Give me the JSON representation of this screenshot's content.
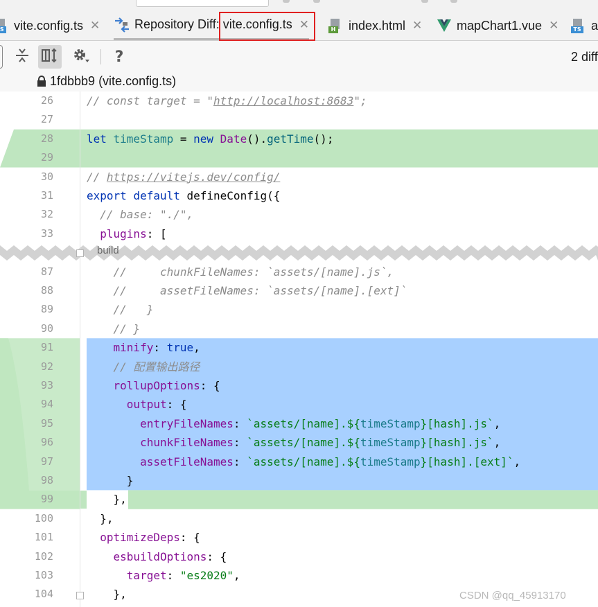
{
  "tabs": [
    {
      "label": "vite.config.ts",
      "icon": "ts-file-icon",
      "active": false
    },
    {
      "label": "Repository Diff: vite.config.ts",
      "icon": "repository-diff-icon",
      "active": true
    },
    {
      "label": "index.html",
      "icon": "html-file-icon",
      "active": false
    },
    {
      "label": "mapChart1.vue",
      "icon": "vue-file-icon",
      "active": false
    },
    {
      "label": "ap",
      "icon": "ts-file-icon",
      "active": false
    }
  ],
  "tab_badges": {
    "ts": "TS",
    "html": "H"
  },
  "toolbar": {
    "buttons": [
      "collapse-unchanged-icon",
      "side-by-side-icon",
      "settings-icon",
      "help-icon"
    ],
    "diff_count": "2 diff"
  },
  "title": "1fdbbb9 (vite.config.ts)",
  "fold_label": "build",
  "colors": {
    "added": "#bfe6c0",
    "modified": "#a8d0ff",
    "highlight_box": "#e02020"
  },
  "lines": [
    {
      "n": "26",
      "code": [
        {
          "t": "// const target = \"",
          "c": "cmt"
        },
        {
          "t": "http://localhost:8683",
          "c": "url"
        },
        {
          "t": "\";",
          "c": "cmt"
        }
      ]
    },
    {
      "n": "27",
      "code": []
    },
    {
      "n": "28",
      "code": [
        {
          "t": "let ",
          "c": "kw"
        },
        {
          "t": "timeStamp",
          "c": "var"
        },
        {
          "t": " = "
        },
        {
          "t": "new ",
          "c": "kw"
        },
        {
          "t": "Date",
          "c": "prop"
        },
        {
          "t": "()."
        },
        {
          "t": "getTime",
          "c": "fn"
        },
        {
          "t": "();"
        }
      ]
    },
    {
      "n": "29",
      "code": []
    },
    {
      "n": "30",
      "code": [
        {
          "t": "// ",
          "c": "cmt"
        },
        {
          "t": "https://vitejs.dev/config/",
          "c": "url"
        }
      ]
    },
    {
      "n": "31",
      "code": [
        {
          "t": "export ",
          "c": "kw"
        },
        {
          "t": "default ",
          "c": "kw"
        },
        {
          "t": "defineConfig({"
        }
      ]
    },
    {
      "n": "32",
      "code": [
        {
          "t": "  // base: \"./\",",
          "c": "cmt"
        }
      ]
    },
    {
      "n": "33",
      "code": [
        {
          "t": "  "
        },
        {
          "t": "plugins",
          "c": "prop"
        },
        {
          "t": ": ["
        }
      ]
    },
    {
      "n": "87",
      "code": [
        {
          "t": "    //     chunkFileNames: `assets/[name].js`,",
          "c": "cmt"
        }
      ]
    },
    {
      "n": "88",
      "code": [
        {
          "t": "    //     assetFileNames: `assets/[name].[ext]`",
          "c": "cmt"
        }
      ]
    },
    {
      "n": "89",
      "code": [
        {
          "t": "    //   }",
          "c": "cmt"
        }
      ]
    },
    {
      "n": "90",
      "code": [
        {
          "t": "    // }",
          "c": "cmt"
        }
      ]
    },
    {
      "n": "91",
      "code": [
        {
          "t": "    "
        },
        {
          "t": "minify",
          "c": "prop"
        },
        {
          "t": ": "
        },
        {
          "t": "true",
          "c": "kw"
        },
        {
          "t": ","
        }
      ]
    },
    {
      "n": "92",
      "code": [
        {
          "t": "    // 配置输出路径",
          "c": "cmt"
        }
      ]
    },
    {
      "n": "93",
      "code": [
        {
          "t": "    "
        },
        {
          "t": "rollupOptions",
          "c": "prop"
        },
        {
          "t": ": {"
        }
      ]
    },
    {
      "n": "94",
      "code": [
        {
          "t": "      "
        },
        {
          "t": "output",
          "c": "prop"
        },
        {
          "t": ": {"
        }
      ]
    },
    {
      "n": "95",
      "code": [
        {
          "t": "        "
        },
        {
          "t": "entryFileNames",
          "c": "prop"
        },
        {
          "t": ": "
        },
        {
          "t": "`assets/[name].${",
          "c": "str"
        },
        {
          "t": "timeStamp",
          "c": "var"
        },
        {
          "t": "}[hash].js`",
          "c": "str"
        },
        {
          "t": ","
        }
      ]
    },
    {
      "n": "96",
      "code": [
        {
          "t": "        "
        },
        {
          "t": "chunkFileNames",
          "c": "prop"
        },
        {
          "t": ": "
        },
        {
          "t": "`assets/[name].${",
          "c": "str"
        },
        {
          "t": "timeStamp",
          "c": "var"
        },
        {
          "t": "}[hash].js`",
          "c": "str"
        },
        {
          "t": ","
        }
      ]
    },
    {
      "n": "97",
      "code": [
        {
          "t": "        "
        },
        {
          "t": "assetFileNames",
          "c": "prop"
        },
        {
          "t": ": "
        },
        {
          "t": "`assets/[name].${",
          "c": "str"
        },
        {
          "t": "timeStamp",
          "c": "var"
        },
        {
          "t": "}[hash].[ext]`",
          "c": "str"
        },
        {
          "t": ","
        }
      ]
    },
    {
      "n": "98",
      "code": [
        {
          "t": "      }"
        }
      ]
    },
    {
      "n": "99",
      "code": [
        {
          "t": "    },"
        }
      ]
    },
    {
      "n": "100",
      "code": [
        {
          "t": "  },"
        }
      ]
    },
    {
      "n": "101",
      "code": [
        {
          "t": "  "
        },
        {
          "t": "optimizeDeps",
          "c": "prop"
        },
        {
          "t": ": {"
        }
      ]
    },
    {
      "n": "102",
      "code": [
        {
          "t": "    "
        },
        {
          "t": "esbuildOptions",
          "c": "prop"
        },
        {
          "t": ": {"
        }
      ]
    },
    {
      "n": "103",
      "code": [
        {
          "t": "      "
        },
        {
          "t": "target",
          "c": "prop"
        },
        {
          "t": ": "
        },
        {
          "t": "\"es2020\"",
          "c": "str"
        },
        {
          "t": ","
        }
      ]
    },
    {
      "n": "104",
      "code": [
        {
          "t": "    },"
        }
      ]
    }
  ],
  "watermark": "CSDN @qq_45913170"
}
